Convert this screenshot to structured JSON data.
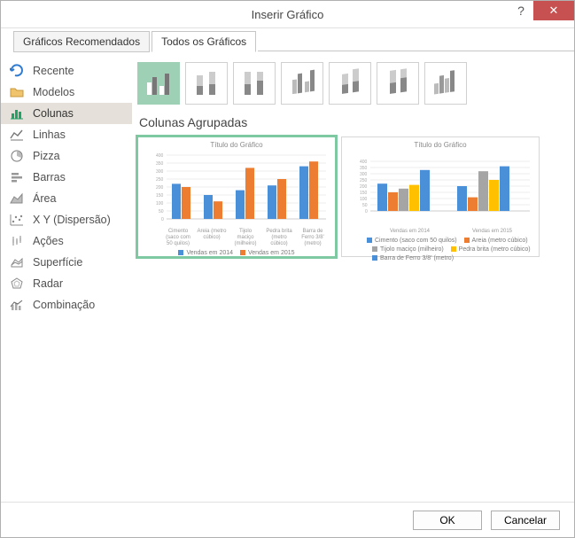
{
  "window": {
    "title": "Inserir Gráfico",
    "help_symbol": "?",
    "close_symbol": "✕"
  },
  "tabs": {
    "recommended": "Gráficos Recomendados",
    "all": "Todos os Gráficos"
  },
  "sidebar": {
    "items": [
      {
        "label": "Recente"
      },
      {
        "label": "Modelos"
      },
      {
        "label": "Colunas"
      },
      {
        "label": "Linhas"
      },
      {
        "label": "Pizza"
      },
      {
        "label": "Barras"
      },
      {
        "label": "Área"
      },
      {
        "label": "X Y (Dispersão)"
      },
      {
        "label": "Ações"
      },
      {
        "label": "Superfície"
      },
      {
        "label": "Radar"
      },
      {
        "label": "Combinação"
      }
    ]
  },
  "subtype_title": "Colunas Agrupadas",
  "previews": {
    "title": "Título do Gráfico",
    "legend_a": {
      "s1": "Vendas em 2014",
      "s2": "Vendas em 2015"
    },
    "xgroups_b": {
      "g1": "Vendas em 2014",
      "g2": "Vendas em 2015"
    },
    "legend_b": {
      "s1": "Cimento (saco com 50 quilos)",
      "s2": "Areia (metro cúbico)",
      "s3": "Tijolo maciço (milheiro)",
      "s4": "Pedra brita (metro cúbico)",
      "s5": "Barra de Ferro 3/8' (metro)"
    },
    "categories_a": {
      "c1": "Cimento (saco com 50 quilos)",
      "c2": "Areia (metro cúbico)",
      "c3": "Tijolo maciço (milheiro)",
      "c4": "Pedra brita (metro cúbico)",
      "c5": "Barra de Ferro 3/8' (metro)"
    }
  },
  "buttons": {
    "ok": "OK",
    "cancel": "Cancelar"
  },
  "colors": {
    "series1": "#4a90d9",
    "series2": "#ed7d31",
    "series3": "#a5a5a5",
    "series4": "#ffc000",
    "brand_green": "#21a366"
  },
  "chart_data": [
    {
      "type": "bar",
      "title": "Título do Gráfico",
      "ylim": [
        0,
        400
      ],
      "yticks": [
        0,
        50,
        100,
        150,
        200,
        250,
        300,
        350,
        400
      ],
      "categories": [
        "Cimento (saco com 50 quilos)",
        "Areia (metro cúbico)",
        "Tijolo maciço (milheiro)",
        "Pedra brita (metro cúbico)",
        "Barra de Ferro 3/8' (metro)"
      ],
      "series": [
        {
          "name": "Vendas em 2014",
          "values": [
            220,
            150,
            180,
            210,
            330
          ]
        },
        {
          "name": "Vendas em 2015",
          "values": [
            200,
            110,
            320,
            250,
            360
          ]
        }
      ]
    },
    {
      "type": "bar",
      "title": "Título do Gráfico",
      "ylim": [
        0,
        400
      ],
      "yticks": [
        0,
        50,
        100,
        150,
        200,
        250,
        300,
        350,
        400
      ],
      "categories": [
        "Vendas em 2014",
        "Vendas em 2015"
      ],
      "series": [
        {
          "name": "Cimento (saco com 50 quilos)",
          "values": [
            220,
            200
          ]
        },
        {
          "name": "Areia (metro cúbico)",
          "values": [
            150,
            110
          ]
        },
        {
          "name": "Tijolo maciço (milheiro)",
          "values": [
            180,
            320
          ]
        },
        {
          "name": "Pedra brita (metro cúbico)",
          "values": [
            210,
            250
          ]
        },
        {
          "name": "Barra de Ferro 3/8' (metro)",
          "values": [
            330,
            360
          ]
        }
      ]
    }
  ]
}
